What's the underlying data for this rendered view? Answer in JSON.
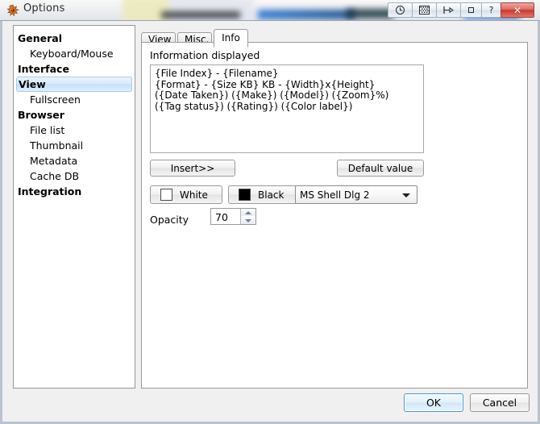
{
  "window": {
    "title": "Options",
    "app_icon": "starburst-icon",
    "titlebar_buttons": [
      {
        "name": "clock-icon",
        "glyph": "◴"
      },
      {
        "name": "checkered-icon",
        "glyph": "▒"
      },
      {
        "name": "pin-icon",
        "glyph": "⊳"
      },
      {
        "name": "minimize-icon",
        "glyph": "▫"
      },
      {
        "name": "help-icon",
        "glyph": "?"
      },
      {
        "name": "close-icon",
        "glyph": "✕"
      }
    ],
    "close_button_color": "#c8372c"
  },
  "sidebar": {
    "items": [
      {
        "label": "General",
        "level": "root",
        "selected": false
      },
      {
        "label": "Keyboard/Mouse",
        "level": "child",
        "selected": false
      },
      {
        "label": "Interface",
        "level": "root",
        "selected": false
      },
      {
        "label": "View",
        "level": "root",
        "selected": true
      },
      {
        "label": "Fullscreen",
        "level": "child",
        "selected": false
      },
      {
        "label": "Browser",
        "level": "root",
        "selected": false
      },
      {
        "label": "File list",
        "level": "child",
        "selected": false
      },
      {
        "label": "Thumbnail",
        "level": "child",
        "selected": false
      },
      {
        "label": "Metadata",
        "level": "child",
        "selected": false
      },
      {
        "label": "Cache DB",
        "level": "child",
        "selected": false
      },
      {
        "label": "Integration",
        "level": "root",
        "selected": false
      }
    ],
    "selection_color": "#c3e0fa"
  },
  "tabs": [
    {
      "label": "View",
      "active": false
    },
    {
      "label": "Misc.",
      "active": false
    },
    {
      "label": "Info",
      "active": true
    }
  ],
  "info_tab": {
    "section_label": "Information displayed",
    "textarea_value": "{File Index} - {Filename}\n{Format} - {Size KB} KB - {Width}x{Height}\n({Date Taken}) ({Make}) ({Model}) ({Zoom}%)\n({Tag status}) ({Rating}) ({Color label})",
    "insert_button": "Insert>>",
    "default_button": "Default value",
    "white_button": "White",
    "white_swatch_color": "#ffffff",
    "black_button": "Black",
    "black_swatch_color": "#000000",
    "font_combo_value": "MS Shell Dlg 2",
    "opacity_label": "Opacity",
    "opacity_value": "70"
  },
  "footer": {
    "ok_label": "OK",
    "cancel_label": "Cancel"
  }
}
